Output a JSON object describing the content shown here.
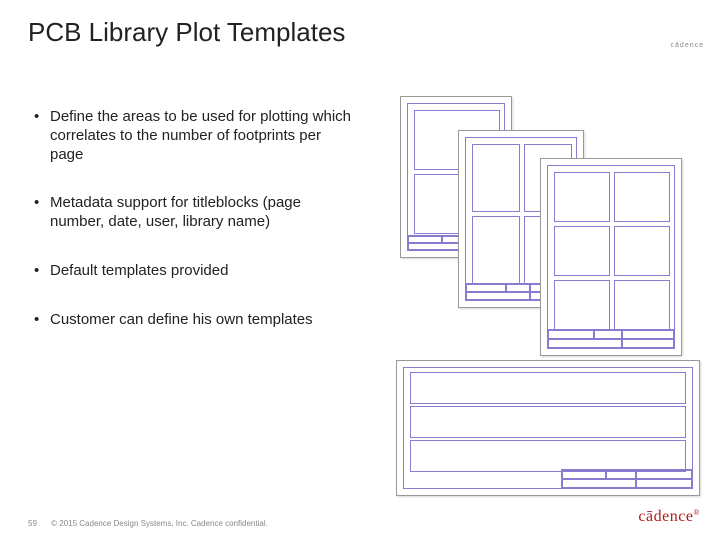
{
  "title": "PCB Library Plot Templates",
  "brand_top": "cādence",
  "bullets": [
    "Define the areas to be used for plotting which correlates to the number of footprints per page",
    "Metadata support for titleblocks (page number, date, user, library name)",
    "Default templates provided",
    "Customer can define his own templates"
  ],
  "footer": {
    "page": "59",
    "copyright": "© 2015 Cadence Design Systems, Inc. Cadence confidential."
  },
  "logo_bottom": "cādence"
}
